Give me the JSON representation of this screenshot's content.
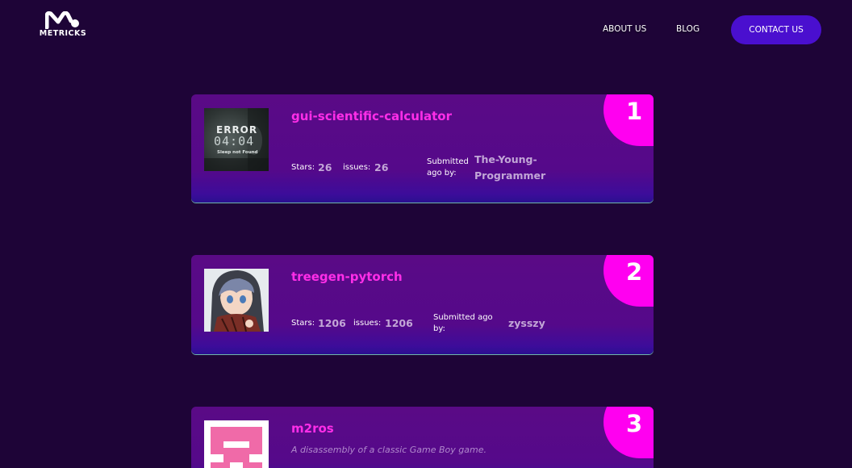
{
  "header": {
    "logo_text": "METRICKS",
    "nav": {
      "about": "ABOUT US",
      "blog": "BLOG",
      "contact": "CONTACT US"
    }
  },
  "colors": {
    "background": "#1e0437",
    "card": "#5a0a86",
    "accent_pink": "#ff00f0",
    "repo_name": "#ff2ee8",
    "contact_button": "#4a0fcf"
  },
  "repos": [
    {
      "rank": "1",
      "name": "gui-scientific-calculator",
      "stars_label": "Stars:",
      "stars": "26",
      "issues_label": "issues:",
      "issues": "26",
      "submitted_label_line1": "Submitted",
      "submitted_label_line2": "ago by:",
      "submitter_line1": "The-Young-",
      "submitter_line2": "Programmer",
      "avatar": {
        "title": "ERROR",
        "code": "04:04",
        "subtitle": "Sleep not Found"
      }
    },
    {
      "rank": "2",
      "name": "treegen-pytorch",
      "stars_label": "Stars:",
      "stars": "1206",
      "issues_label": "issues:",
      "issues": "1206",
      "submitted_label_line1": "Submitted ago",
      "submitted_label_line2": "by:",
      "submitter_line1": "zysszy"
    },
    {
      "rank": "3",
      "name": "m2ros",
      "description": "A disassembly of a classic Game Boy game."
    }
  ]
}
